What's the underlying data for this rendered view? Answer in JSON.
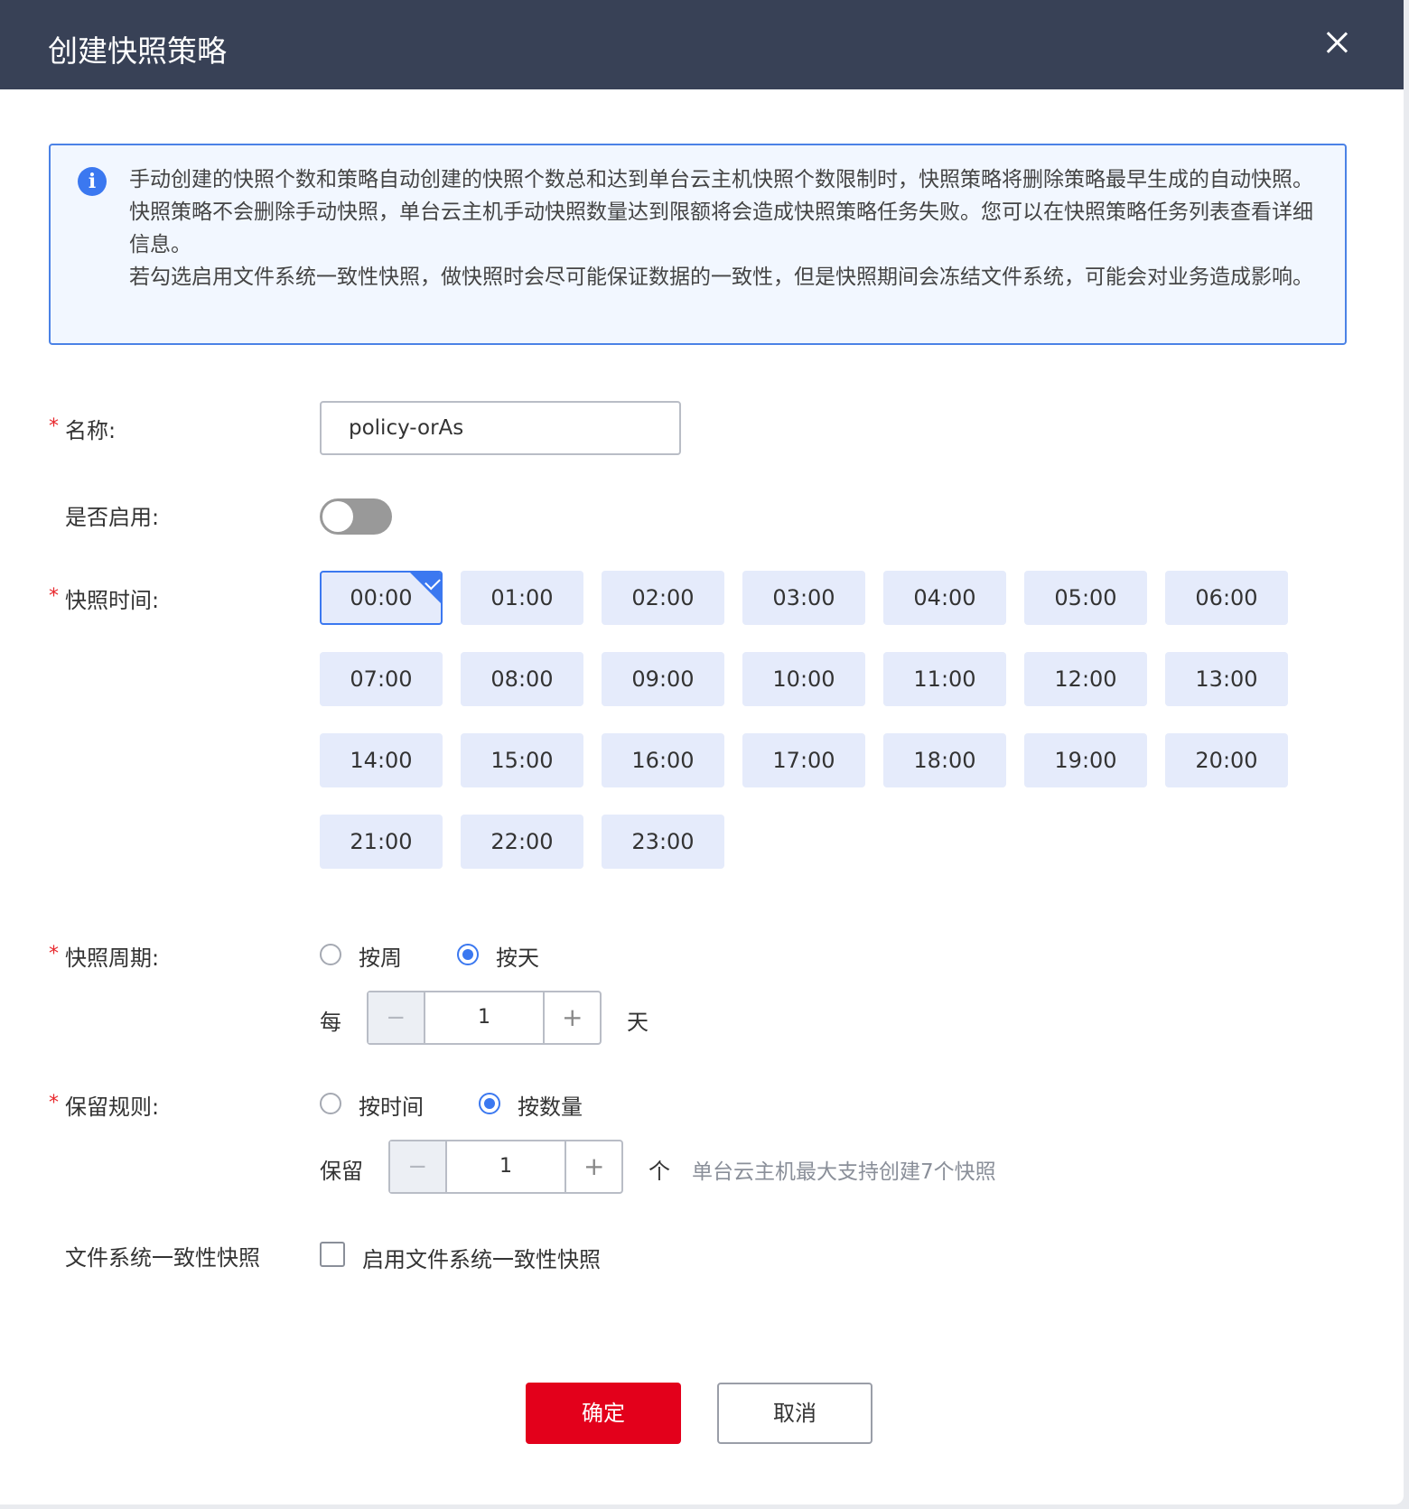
{
  "dialog": {
    "title": "创建快照策略"
  },
  "notice": {
    "line1": "手动创建的快照个数和策略自动创建的快照个数总和达到单台云主机快照个数限制时，快照策略将删除策略最早生成的自动快照。快照策略不会删除手动快照，单台云主机手动快照数量达到限额将会造成快照策略任务失败。您可以在快照策略任务列表查看详细信息。",
    "line2": "若勾选启用文件系统一致性快照，做快照时会尽可能保证数据的一致性，但是快照期间会冻结文件系统，可能会对业务造成影响。"
  },
  "form": {
    "required_mark": "*",
    "name_label": "名称:",
    "name_value": "policy-orAs",
    "enabled_label": "是否启用:",
    "enabled": false,
    "time_label": "快照时间:",
    "hours": [
      "00:00",
      "01:00",
      "02:00",
      "03:00",
      "04:00",
      "05:00",
      "06:00",
      "07:00",
      "08:00",
      "09:00",
      "10:00",
      "11:00",
      "12:00",
      "13:00",
      "14:00",
      "15:00",
      "16:00",
      "17:00",
      "18:00",
      "19:00",
      "20:00",
      "21:00",
      "22:00",
      "23:00"
    ],
    "selected_hour": "00:00",
    "period_label": "快照周期:",
    "period_options": [
      "按周",
      "按天"
    ],
    "period_selected": "按天",
    "every_prefix": "每",
    "every_value": "1",
    "every_suffix": "天",
    "retention_label": "保留规则:",
    "retention_options": [
      "按时间",
      "按数量"
    ],
    "retention_selected": "按数量",
    "keep_prefix": "保留",
    "keep_value": "1",
    "keep_suffix": "个",
    "keep_hint": "单台云主机最大支持创建7个快照",
    "fs_label": "文件系统一致性快照",
    "fs_checkbox_label": "启用文件系统一致性快照",
    "fs_checked": false,
    "minus_symbol": "−",
    "plus_symbol": "+"
  },
  "buttons": {
    "confirm": "确定",
    "cancel": "取消"
  },
  "colors": {
    "header_bg": "#384156",
    "accent": "#3b78f0",
    "primary_button": "#e3001b",
    "hour_chip_bg": "#e5ebfb",
    "required": "#e8282d"
  }
}
